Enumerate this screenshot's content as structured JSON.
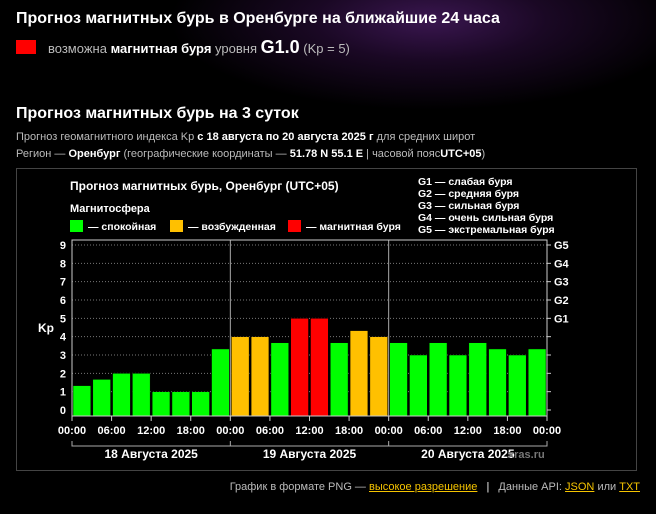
{
  "header": {
    "title": "Прогноз магнитных бурь в Оренбурге на ближайшие 24 часа",
    "status_prefix": "возможна",
    "status_bold": "магнитная буря",
    "status_level_word": "уровня",
    "status_level": "G1.0",
    "status_kp": "(Kp = 5)",
    "status_color": "#ff0000"
  },
  "forecast": {
    "title": "Прогноз магнитных бурь на 3 суток",
    "line1_a": "Прогноз геомагнитного индекса Kp",
    "line1_b": "с 18 августа по 20 августа 2025 г",
    "line1_c": "для средних широт",
    "line2_a": "Регион —",
    "line2_b": "Оренбург",
    "line2_c": "(географические координаты —",
    "line2_d": "51.78 N 55.1 E",
    "line2_e": "| часовой пояс",
    "line2_f": "UTC+05",
    "line2_g": ")"
  },
  "chart_data": {
    "type": "bar",
    "title": "Прогноз магнитных бурь, Оренбург (UTC+05)",
    "legend_title": "Магнитосфера",
    "legend": [
      {
        "label": "— спокойная",
        "color": "#00ff00"
      },
      {
        "label": "— возбужденная",
        "color": "#ffc000"
      },
      {
        "label": "— магнитная буря",
        "color": "#ff0000"
      }
    ],
    "g_legend": [
      "G1 — слабая буря",
      "G2 — средняя буря",
      "G3 — сильная буря",
      "G4 — очень сильная буря",
      "G5 — экстремальная буря"
    ],
    "ylabel": "Kp",
    "ylim": [
      0,
      9
    ],
    "yticks": [
      "0",
      "1",
      "2",
      "3",
      "4",
      "5",
      "6",
      "7",
      "8",
      "9"
    ],
    "right_ticks": [
      {
        "label": "G1",
        "kp": 5
      },
      {
        "label": "G2",
        "kp": 6
      },
      {
        "label": "G3",
        "kp": 7
      },
      {
        "label": "G4",
        "kp": 8
      },
      {
        "label": "G5",
        "kp": 9
      }
    ],
    "xticks": [
      "00:00",
      "06:00",
      "12:00",
      "18:00",
      "00:00",
      "06:00",
      "12:00",
      "18:00",
      "00:00",
      "06:00",
      "12:00",
      "18:00",
      "00:00"
    ],
    "days": [
      "18 Августа 2025",
      "19 Августа 2025",
      "20 Августа 2025"
    ],
    "watermark": "xras.ru",
    "values": [
      1.33,
      1.67,
      2,
      2,
      1,
      1,
      1,
      3.33,
      4,
      4,
      3.67,
      5,
      5,
      3.67,
      4.33,
      4,
      3.67,
      3,
      3.67,
      3,
      3.67,
      3.33,
      3,
      3.33
    ],
    "colors": [
      "#00ff00",
      "#00ff00",
      "#00ff00",
      "#00ff00",
      "#00ff00",
      "#00ff00",
      "#00ff00",
      "#00ff00",
      "#ffc000",
      "#ffc000",
      "#00ff00",
      "#ff0000",
      "#ff0000",
      "#00ff00",
      "#ffc000",
      "#ffc000",
      "#00ff00",
      "#00ff00",
      "#00ff00",
      "#00ff00",
      "#00ff00",
      "#00ff00",
      "#00ff00",
      "#00ff00"
    ]
  },
  "footer": {
    "png_text": "График в формате PNG —",
    "png_link": "высокое разрешение",
    "api_text": "Данные API:",
    "json_link": "JSON",
    "or": "или",
    "txt_link": "TXT"
  }
}
